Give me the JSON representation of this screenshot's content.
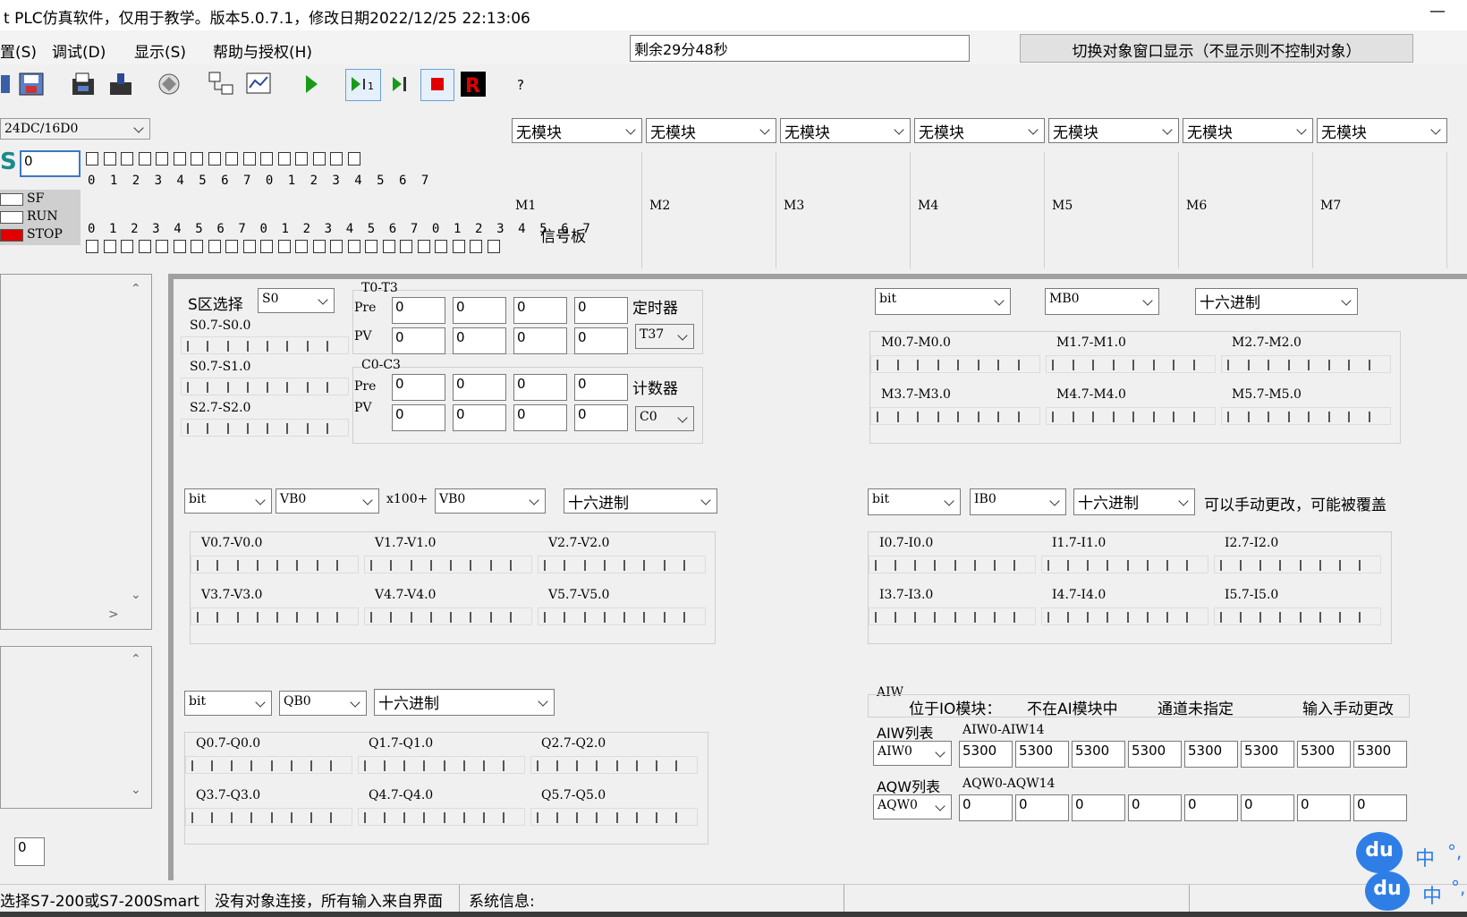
{
  "window": {
    "title": "t PLC仿真软件，仅用于教学。版本5.0.7.1，修改日期2022/12/25 22:13:06",
    "minimize": "—"
  },
  "menu": [
    "置(S)",
    "调试(D)",
    "显示(S)",
    "帮助与授权(H)"
  ],
  "timer_text": "剩余29分48秒",
  "toggle_button": "切换对象窗口显示（不显示则不控制对象）",
  "toolbar_help": "?",
  "cpu": {
    "select": "24DC/16D0",
    "logo": "S",
    "addr": "0",
    "top_digits": "0 1 2 3 4 5 6 7 0 1 2 3 4 5 6 7",
    "bot_digits": "0 1 2 3 4 5 6 7 0 1 2 3 4 5 6 7 0 1 2 3 4 5 6 7",
    "leds": [
      "SF",
      "RUN",
      "STOP"
    ],
    "stop_color": "#e00000"
  },
  "modules": {
    "options": [
      "无模块",
      "无模块",
      "无模块",
      "无模块",
      "无模块",
      "无模块",
      "无模块"
    ],
    "labels": [
      "M1",
      "M2",
      "M3",
      "M4",
      "M5",
      "M6",
      "M7"
    ],
    "signal_board": "信号板"
  },
  "s_area": {
    "label": "S区选择",
    "select": "S0",
    "rows": [
      "S0.7-S0.0",
      "S0.7-S1.0",
      "S2.7-S2.0"
    ]
  },
  "timers": {
    "group": "T0-T3",
    "pre": "Pre",
    "pv": "PV",
    "pre_vals": [
      "0",
      "0",
      "0",
      "0"
    ],
    "pv_vals": [
      "0",
      "0",
      "0",
      "0"
    ],
    "label": "定时器",
    "select": "T37"
  },
  "counters": {
    "group": "C0-C3",
    "pre": "Pre",
    "pv": "PV",
    "pre_vals": [
      "0",
      "0",
      "0",
      "0"
    ],
    "pv_vals": [
      "0",
      "0",
      "0",
      "0"
    ],
    "label": "计数器",
    "select": "C0"
  },
  "v_area": {
    "type": "bit",
    "base": "VB0",
    "mult": "x100+",
    "offset": "VB0",
    "fmt": "十六进制",
    "rows": [
      "V0.7-V0.0",
      "V1.7-V1.0",
      "V2.7-V2.0",
      "V3.7-V3.0",
      "V4.7-V4.0",
      "V5.7-V5.0"
    ]
  },
  "q_area": {
    "type": "bit",
    "base": "QB0",
    "fmt": "十六进制",
    "rows": [
      "Q0.7-Q0.0",
      "Q1.7-Q1.0",
      "Q2.7-Q2.0",
      "Q3.7-Q3.0",
      "Q4.7-Q4.0",
      "Q5.7-Q5.0"
    ]
  },
  "m_area": {
    "type": "bit",
    "base": "MB0",
    "fmt": "十六进制",
    "rows": [
      "M0.7-M0.0",
      "M1.7-M1.0",
      "M2.7-M2.0",
      "M3.7-M3.0",
      "M4.7-M4.0",
      "M5.7-M5.0"
    ]
  },
  "i_area": {
    "type": "bit",
    "base": "IB0",
    "fmt": "十六进制",
    "note": "可以手动更改，可能被覆盖",
    "rows": [
      "I0.7-I0.0",
      "I1.7-I1.0",
      "I2.7-I2.0",
      "I3.7-I3.0",
      "I4.7-I4.0",
      "I5.7-I5.0"
    ]
  },
  "analog": {
    "aiw": "AIW",
    "io_label": "位于IO模块：",
    "ai_status": "不在AI模块中",
    "channel": "通道未指定",
    "manual": "输入手动更改",
    "aiw_list": "AIW列表",
    "aiw_range": "AIW0-AIW14",
    "aiw_select": "AIW0",
    "aiw_vals": [
      "5300",
      "5300",
      "5300",
      "5300",
      "5300",
      "5300",
      "5300",
      "5300"
    ],
    "aqw_list": "AQW列表",
    "aqw_range": "AQW0-AQW14",
    "aqw_select": "AQW0",
    "aqw_vals": [
      "0",
      "0",
      "0",
      "0",
      "0",
      "0",
      "0",
      "0"
    ]
  },
  "left_field": "0",
  "status": {
    "s1": "选择S7-200或S7-200Smart",
    "s2": "没有对象连接，所有输入来自界面",
    "s3": "系统信息:"
  },
  "ime": {
    "label": "中",
    "logo": "du",
    "dots": "°,"
  }
}
